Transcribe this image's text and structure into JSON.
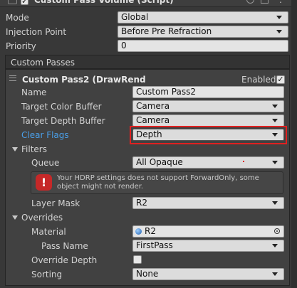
{
  "header": {
    "title": "Custom Pass Volume (Script)",
    "enabled": true
  },
  "fields": {
    "mode": {
      "label": "Mode",
      "value": "Global"
    },
    "injection_point": {
      "label": "Injection Point",
      "value": "Before Pre Refraction"
    },
    "priority": {
      "label": "Priority",
      "value": "0"
    }
  },
  "custom_passes": {
    "section_title": "Custom Passes",
    "pass": {
      "title": "Custom Pass2 (DrawRend",
      "enabled_label": "Enabled",
      "enabled": true,
      "name": {
        "label": "Name",
        "value": "Custom Pass2"
      },
      "target_color_buffer": {
        "label": "Target Color Buffer",
        "value": "Camera"
      },
      "target_depth_buffer": {
        "label": "Target Depth Buffer",
        "value": "Camera"
      },
      "clear_flags": {
        "label": "Clear Flags",
        "value": "Depth"
      },
      "filters": {
        "label": "Filters",
        "queue": {
          "label": "Queue",
          "value": "All Opaque"
        },
        "warning": "Your HDRP settings does not support ForwardOnly, some object might not render.",
        "layer_mask": {
          "label": "Layer Mask",
          "value": "R2"
        }
      },
      "overrides": {
        "label": "Overrides",
        "material": {
          "label": "Material",
          "value": "R2"
        },
        "pass_name": {
          "label": "Pass Name",
          "value": "FirstPass"
        },
        "override_depth": {
          "label": "Override Depth",
          "checked": false
        },
        "sorting": {
          "label": "Sorting",
          "value": "None"
        }
      }
    }
  },
  "colors": {
    "panel_bg": "#383838",
    "highlight_border": "#e02020",
    "modified_label": "#4a9fe8",
    "warning_red": "#c62828"
  }
}
